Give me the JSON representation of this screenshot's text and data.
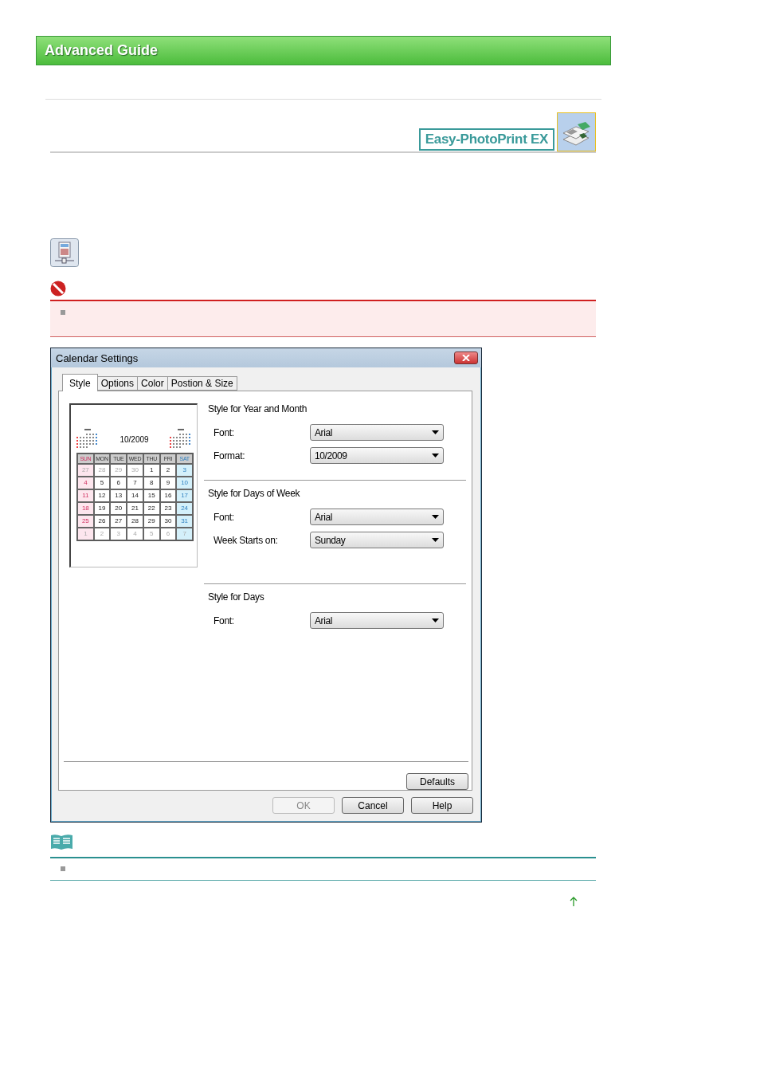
{
  "header": {
    "title": "Advanced Guide"
  },
  "product": {
    "logo_text": "Easy-PhotoPrint EX"
  },
  "dialog": {
    "title": "Calendar Settings",
    "tabs": [
      {
        "label": "Style",
        "selected": true
      },
      {
        "label": "Options",
        "selected": false
      },
      {
        "label": "Color",
        "selected": false
      },
      {
        "label": "Postion & Size",
        "selected": false
      }
    ],
    "preview": {
      "title": "10/2009",
      "weekdays": [
        "SUN",
        "MON",
        "TUE",
        "WED",
        "THU",
        "FRI",
        "SAT"
      ],
      "weeks": [
        [
          {
            "day": "27",
            "muted": true
          },
          {
            "day": "28",
            "muted": true
          },
          {
            "day": "29",
            "muted": true
          },
          {
            "day": "30",
            "muted": true
          },
          {
            "day": "1",
            "muted": false
          },
          {
            "day": "2",
            "muted": false
          },
          {
            "day": "3",
            "muted": false
          }
        ],
        [
          {
            "day": "4",
            "muted": false
          },
          {
            "day": "5",
            "muted": false
          },
          {
            "day": "6",
            "muted": false
          },
          {
            "day": "7",
            "muted": false
          },
          {
            "day": "8",
            "muted": false
          },
          {
            "day": "9",
            "muted": false
          },
          {
            "day": "10",
            "muted": false
          }
        ],
        [
          {
            "day": "11",
            "muted": false
          },
          {
            "day": "12",
            "muted": false
          },
          {
            "day": "13",
            "muted": false
          },
          {
            "day": "14",
            "muted": false
          },
          {
            "day": "15",
            "muted": false
          },
          {
            "day": "16",
            "muted": false
          },
          {
            "day": "17",
            "muted": false
          }
        ],
        [
          {
            "day": "18",
            "muted": false
          },
          {
            "day": "19",
            "muted": false
          },
          {
            "day": "20",
            "muted": false
          },
          {
            "day": "21",
            "muted": false
          },
          {
            "day": "22",
            "muted": false
          },
          {
            "day": "23",
            "muted": false
          },
          {
            "day": "24",
            "muted": false
          }
        ],
        [
          {
            "day": "25",
            "muted": false
          },
          {
            "day": "26",
            "muted": false
          },
          {
            "day": "27",
            "muted": false
          },
          {
            "day": "28",
            "muted": false
          },
          {
            "day": "29",
            "muted": false
          },
          {
            "day": "30",
            "muted": false
          },
          {
            "day": "31",
            "muted": false
          }
        ],
        [
          {
            "day": "1",
            "muted": true
          },
          {
            "day": "2",
            "muted": true
          },
          {
            "day": "3",
            "muted": true
          },
          {
            "day": "4",
            "muted": true
          },
          {
            "day": "5",
            "muted": true
          },
          {
            "day": "6",
            "muted": true
          },
          {
            "day": "7",
            "muted": true
          }
        ]
      ]
    },
    "sections": [
      {
        "title": "Style for Year and Month",
        "fields": [
          {
            "label": "Font:",
            "value": "Arial"
          },
          {
            "label": "Format:",
            "value": "10/2009"
          }
        ]
      },
      {
        "title": "Style for Days of Week",
        "fields": [
          {
            "label": "Font:",
            "value": "Arial"
          },
          {
            "label": "Week Starts on:",
            "value": "Sunday"
          }
        ]
      },
      {
        "title": "Style for Days",
        "fields": [
          {
            "label": "Font:",
            "value": "Arial"
          }
        ]
      }
    ],
    "defaults_button": "Defaults",
    "buttons": [
      {
        "label": "OK",
        "disabled": true
      },
      {
        "label": "Cancel",
        "disabled": false
      },
      {
        "label": "Help",
        "disabled": false
      }
    ]
  }
}
